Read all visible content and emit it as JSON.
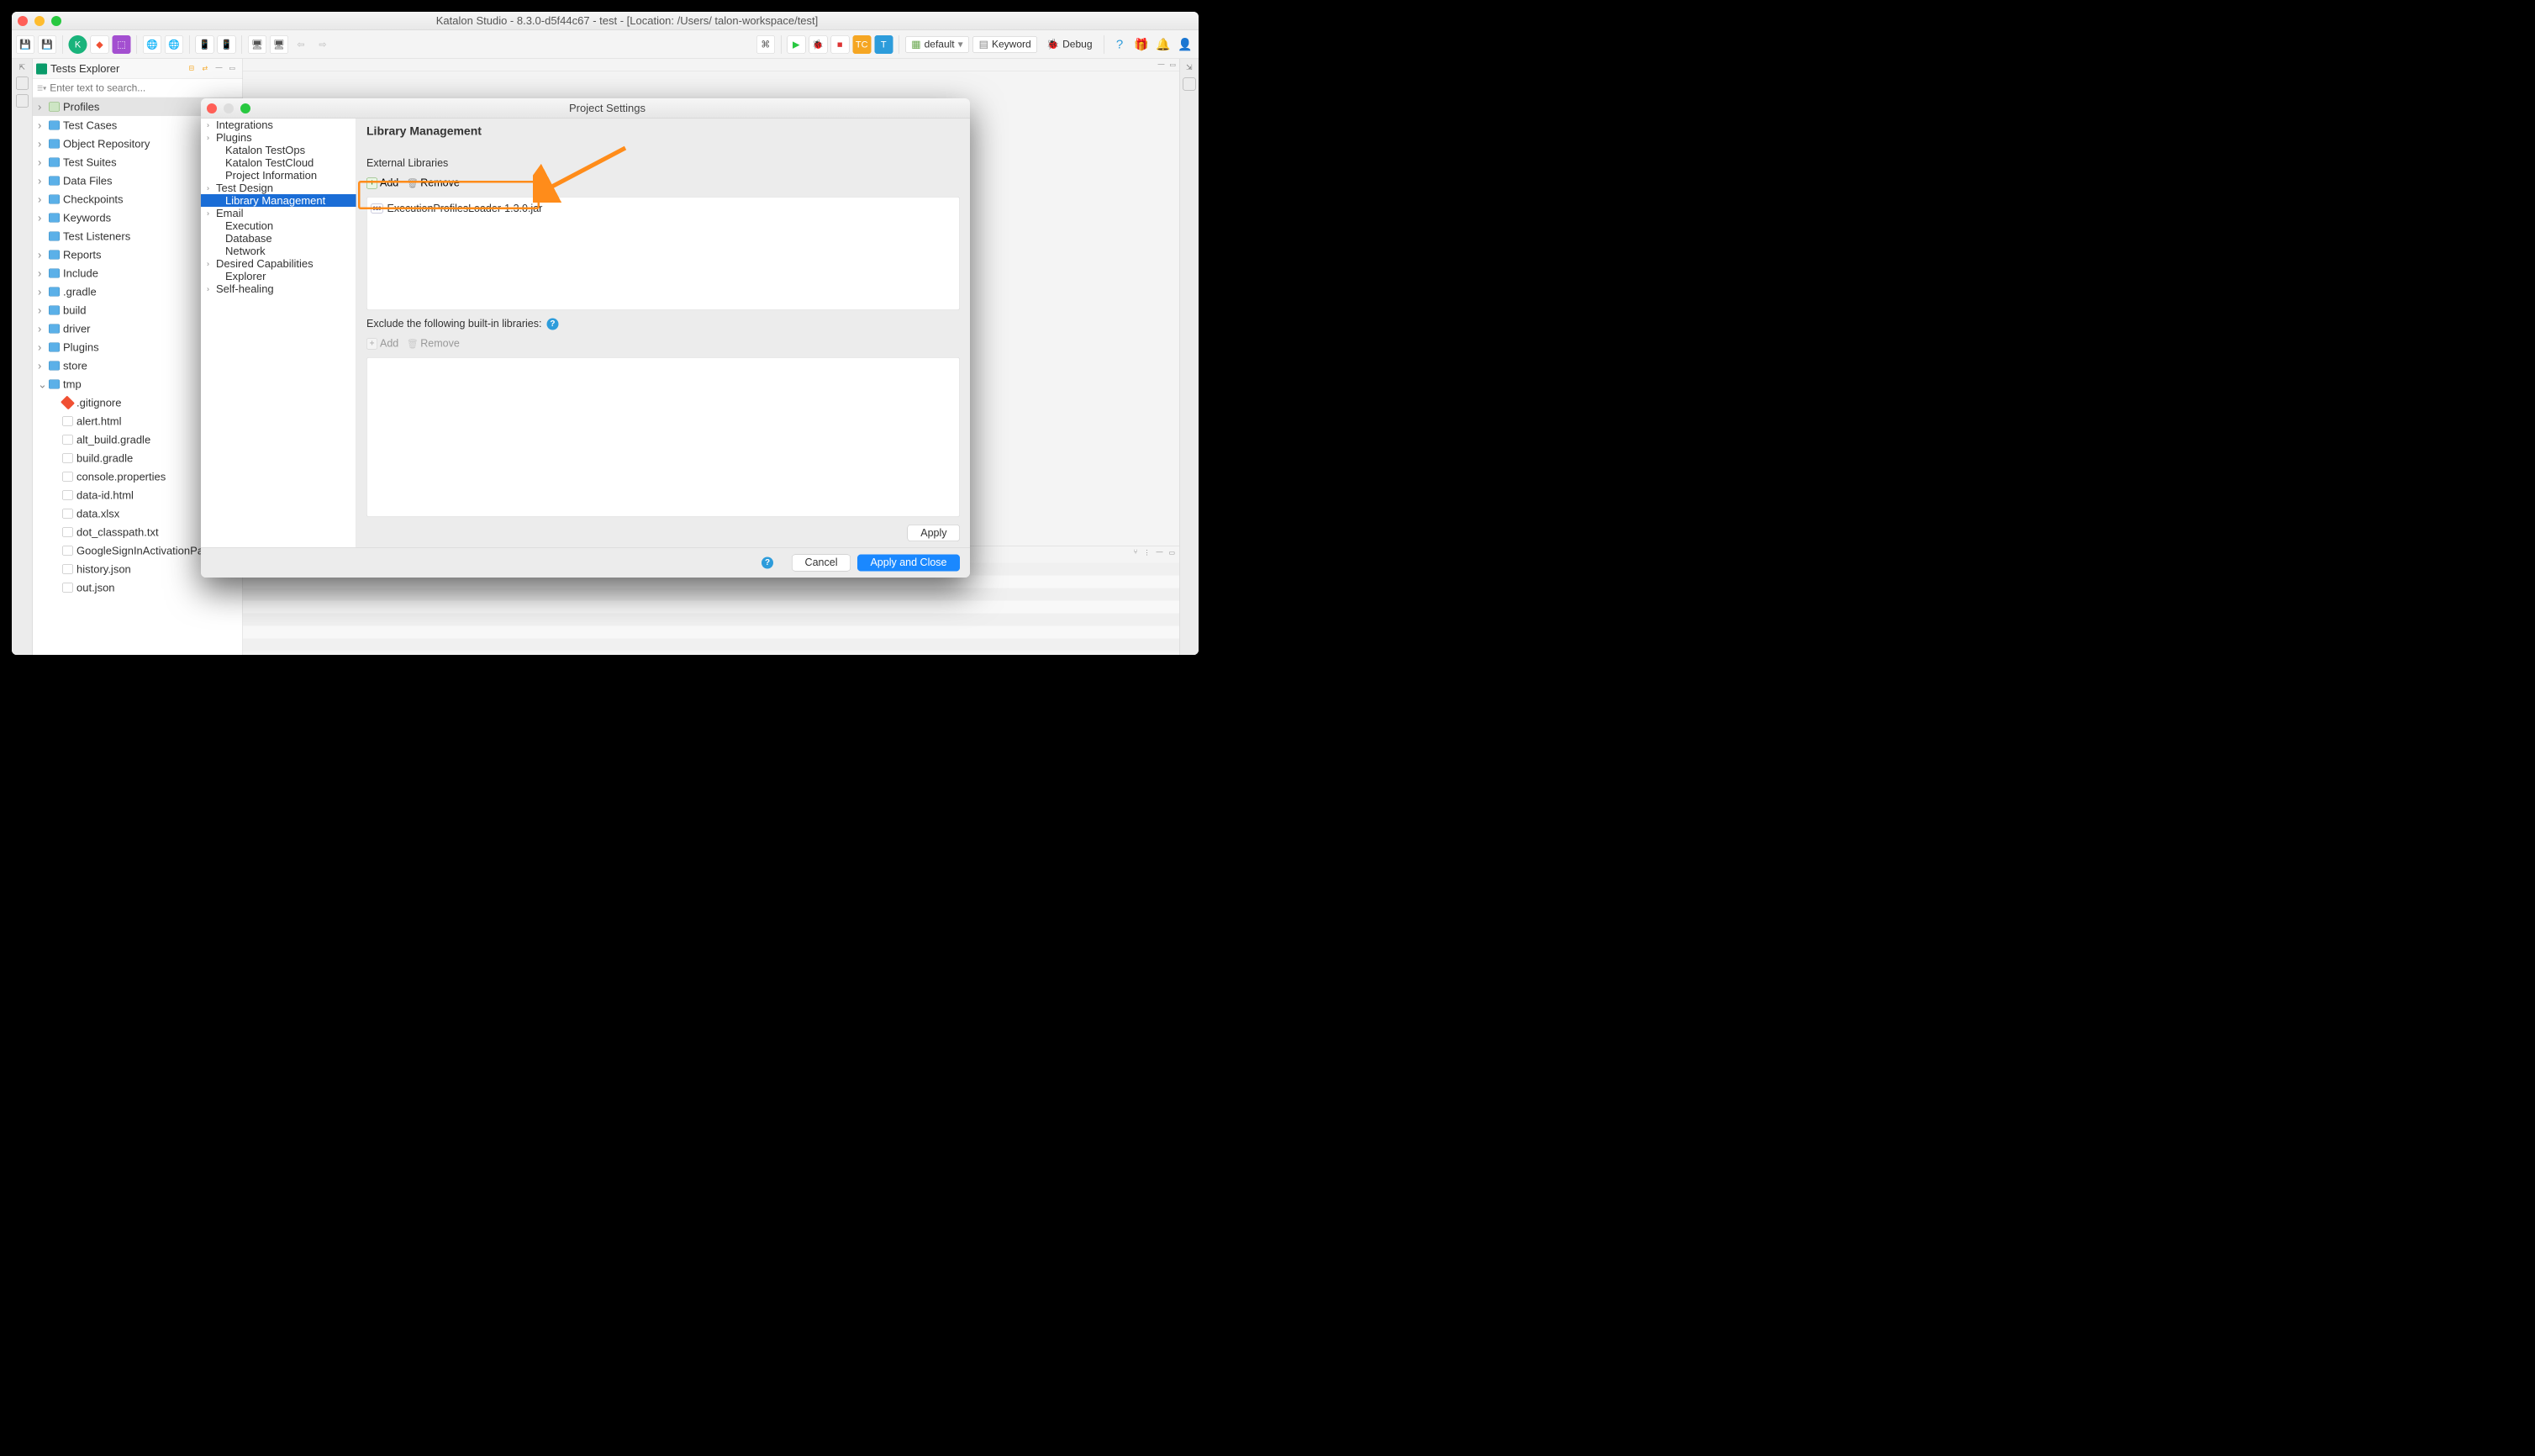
{
  "window": {
    "title": "Katalon Studio - 8.3.0-d5f44c67 - test - [Location: /Users/          talon-workspace/test]"
  },
  "toolbar": {
    "profile_label": "default",
    "mode_label": "Keyword",
    "debug_label": "Debug"
  },
  "explorer": {
    "title": "Tests Explorer",
    "search_placeholder": "Enter text to search...",
    "nodes": [
      {
        "label": "Profiles",
        "icon": "profile",
        "chev": ">",
        "sel": true
      },
      {
        "label": "Test Cases",
        "icon": "folder",
        "chev": ">"
      },
      {
        "label": "Object Repository",
        "icon": "folder",
        "chev": ">"
      },
      {
        "label": "Test Suites",
        "icon": "folder",
        "chev": ">"
      },
      {
        "label": "Data Files",
        "icon": "folder",
        "chev": ">"
      },
      {
        "label": "Checkpoints",
        "icon": "folder",
        "chev": ">"
      },
      {
        "label": "Keywords",
        "icon": "folder",
        "chev": ">"
      },
      {
        "label": "Test Listeners",
        "icon": "folder",
        "chev": ""
      },
      {
        "label": "Reports",
        "icon": "folder",
        "chev": ">"
      },
      {
        "label": "Include",
        "icon": "folder",
        "chev": ">"
      },
      {
        "label": ".gradle",
        "icon": "folder",
        "chev": ">"
      },
      {
        "label": "build",
        "icon": "folder",
        "chev": ">"
      },
      {
        "label": "driver",
        "icon": "folder",
        "chev": ">"
      },
      {
        "label": "Plugins",
        "icon": "folder",
        "chev": ">"
      },
      {
        "label": "store",
        "icon": "folder",
        "chev": ">"
      },
      {
        "label": "tmp",
        "icon": "folder",
        "chev": "v"
      },
      {
        "label": ".gitignore",
        "icon": "git",
        "chev": "",
        "indent": true
      },
      {
        "label": "alert.html",
        "icon": "file",
        "chev": "",
        "indent": true
      },
      {
        "label": "alt_build.gradle",
        "icon": "file",
        "chev": "",
        "indent": true
      },
      {
        "label": "build.gradle",
        "icon": "file",
        "chev": "",
        "indent": true
      },
      {
        "label": "console.properties",
        "icon": "file",
        "chev": "",
        "indent": true
      },
      {
        "label": "data-id.html",
        "icon": "file",
        "chev": "",
        "indent": true
      },
      {
        "label": "data.xlsx",
        "icon": "file",
        "chev": "",
        "indent": true
      },
      {
        "label": "dot_classpath.txt",
        "icon": "file",
        "chev": "",
        "indent": true
      },
      {
        "label": "GoogleSignInActivationPage.html",
        "icon": "file",
        "chev": "",
        "indent": true
      },
      {
        "label": "history.json",
        "icon": "file",
        "chev": "",
        "indent": true
      },
      {
        "label": "out.json",
        "icon": "file",
        "chev": "",
        "indent": true
      }
    ]
  },
  "dialog": {
    "title": "Project Settings",
    "side_items": [
      {
        "label": "Integrations",
        "chev": ">"
      },
      {
        "label": "Plugins",
        "chev": ">"
      },
      {
        "label": "Katalon TestOps",
        "chev": "",
        "indent": true
      },
      {
        "label": "Katalon TestCloud",
        "chev": "",
        "indent": true
      },
      {
        "label": "Project Information",
        "chev": "",
        "indent": true
      },
      {
        "label": "Test Design",
        "chev": ">"
      },
      {
        "label": "Library Management",
        "chev": "",
        "indent": true,
        "sel": true
      },
      {
        "label": "Email",
        "chev": ">"
      },
      {
        "label": "Execution",
        "chev": "",
        "indent": true
      },
      {
        "label": "Database",
        "chev": "",
        "indent": true
      },
      {
        "label": "Network",
        "chev": "",
        "indent": true
      },
      {
        "label": "Desired Capabilities",
        "chev": ">"
      },
      {
        "label": "Explorer",
        "chev": "",
        "indent": true
      },
      {
        "label": "Self-healing",
        "chev": ">"
      }
    ],
    "main": {
      "heading": "Library Management",
      "external_label": "External Libraries",
      "add_label": "Add",
      "remove_label": "Remove",
      "jar_file": "ExecutionProfilesLoader-1.3.0.jar",
      "exclude_label": "Exclude the following built-in libraries:",
      "apply_label": "Apply",
      "cancel_label": "Cancel",
      "apply_close_label": "Apply and Close"
    }
  }
}
